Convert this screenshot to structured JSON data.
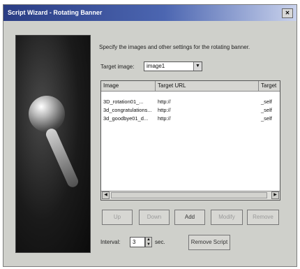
{
  "window": {
    "title": "Script Wizard - Rotating Banner",
    "close_label": "✕"
  },
  "description": "Specify the images and other settings for the rotating banner.",
  "target_image": {
    "label": "Target image:",
    "value": "image1"
  },
  "list": {
    "columns": [
      "Image",
      "Target URL",
      "Target"
    ],
    "rows": [
      {
        "image": "3D_rotation01_...",
        "url": "http://",
        "target": "_self"
      },
      {
        "image": "3d_congratulations...",
        "url": "http://",
        "target": "_self"
      },
      {
        "image": "3d_goodbye01_d...",
        "url": "http://",
        "target": "_self"
      }
    ]
  },
  "buttons": {
    "up": "Up",
    "down": "Down",
    "add": "Add",
    "modify": "Modify",
    "remove": "Remove"
  },
  "interval": {
    "label": "Interval:",
    "value": "3",
    "unit": "sec."
  },
  "remove_script": "Remove Script"
}
